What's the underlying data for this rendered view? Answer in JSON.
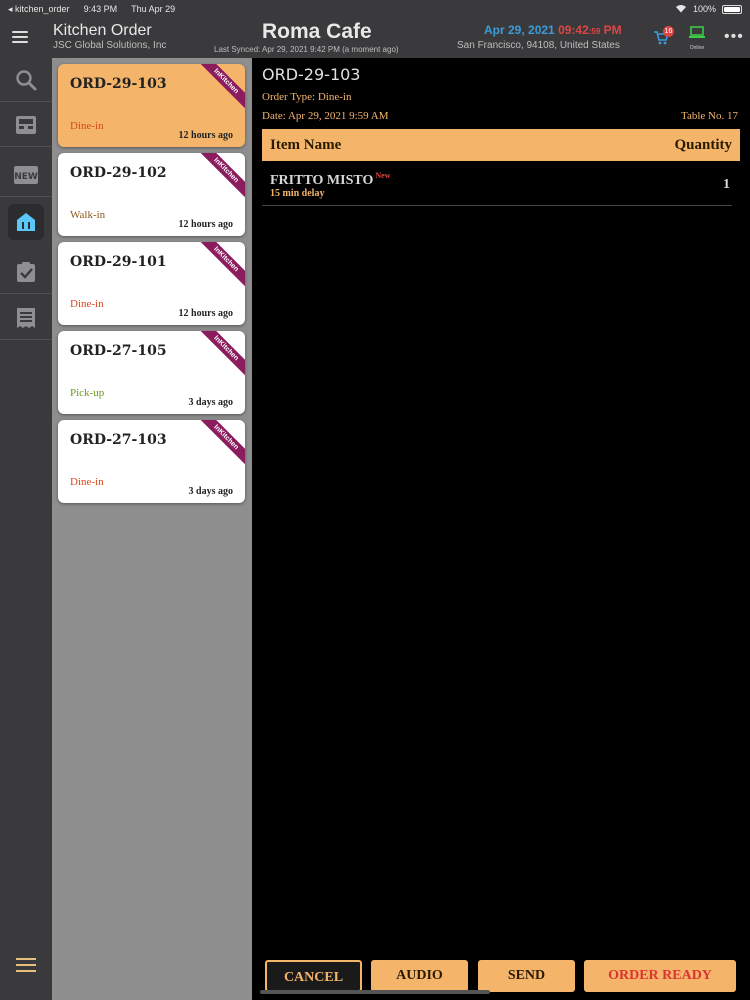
{
  "status_bar": {
    "back_app": "◂ kitchen_order",
    "time": "9:43 PM",
    "date": "Thu Apr 29",
    "battery": "100%"
  },
  "header": {
    "app_title": "Kitchen Order",
    "company": "JSC Global Solutions, Inc",
    "cafe_name": "Roma Cafe",
    "last_synced": "Last Synced: Apr 29, 2021 9:42 PM (a moment ago)",
    "date": "Apr 29, 2021",
    "time": "09:42",
    "seconds": ":59",
    "ampm": "PM",
    "location": "San Francisco, 94108, United States",
    "cart_count": "16",
    "online_label": "Online"
  },
  "orders": [
    {
      "id": "ORD-29-103",
      "type": "Dine-in",
      "ago": "12 hours ago",
      "badge": "InKitchen",
      "type_color": "#d9481e"
    },
    {
      "id": "ORD-29-102",
      "type": "Walk-in",
      "ago": "12 hours ago",
      "badge": "InKitchen",
      "type_color": "#8a5a1a"
    },
    {
      "id": "ORD-29-101",
      "type": "Dine-in",
      "ago": "12 hours ago",
      "badge": "InKitchen",
      "type_color": "#d9481e"
    },
    {
      "id": "ORD-27-105",
      "type": "Pick-up",
      "ago": "3 days ago",
      "badge": "InKitchen",
      "type_color": "#6a9a1a"
    },
    {
      "id": "ORD-27-103",
      "type": "Dine-in",
      "ago": "3 days ago",
      "badge": "InKitchen",
      "type_color": "#d9481e"
    }
  ],
  "detail": {
    "order_id": "ORD-29-103",
    "order_type": "Order Type: Dine-in",
    "date": "Date: Apr 29, 2021 9:59 AM",
    "table": "Table No. 17",
    "col_item": "Item Name",
    "col_qty": "Quantity",
    "items": [
      {
        "name": "FRITTO MISTO",
        "tag": "New",
        "note": "15 min delay",
        "qty": "1"
      }
    ]
  },
  "actions": {
    "cancel": "CANCEL",
    "audio": "AUDIO",
    "send": "SEND",
    "ready": "ORDER READY"
  }
}
